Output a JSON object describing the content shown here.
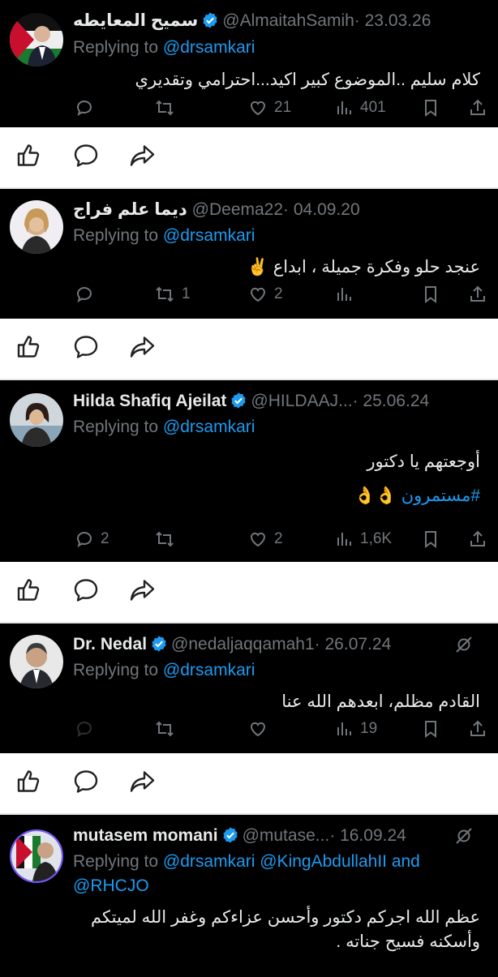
{
  "replying_label": "Replying to",
  "tweets": [
    {
      "name": "سميح المعايطه",
      "handle": "@AlmaitahSamih",
      "date": "· 23.03.26",
      "mention": "@drsamkari",
      "text": "كلام سليم ..الموضوع كبير اكيد...احترامي وتقديري",
      "replies": "",
      "retweets": "",
      "likes": "21",
      "views": "401"
    },
    {
      "name": "ديما علم فراج",
      "handle": "@Deema22",
      "date": "· 04.09.20",
      "mention": "@drsamkari",
      "text": "عنجد حلو وفكرة جميلة ، ابداع ✌️",
      "replies": "",
      "retweets": "1",
      "likes": "2",
      "views": ""
    },
    {
      "name": "Hilda Shafiq Ajeilat",
      "handle": "@HILDAAJ...",
      "date": "· 25.06.24",
      "mention": "@drsamkari",
      "text": "أوجعتهم يا دكتور",
      "hashtag": "#مستمرون",
      "emoji": "👌👌",
      "replies": "2",
      "retweets": "",
      "likes": "2",
      "views": "1,6K"
    },
    {
      "name": "Dr. Nedal",
      "handle": "@nedaljaqqamah1",
      "date": "· 26.07.24",
      "mention": "@drsamkari",
      "text": "القادم مظلم، ابعدهم الله عنا",
      "replies": "",
      "retweets": "",
      "likes": "",
      "views": "19"
    },
    {
      "name": "mutasem momani",
      "handle": "@mutase...",
      "date": "· 16.09.24",
      "mention": "@drsamkari @KingAbdullahII and",
      "mention2": "@RHCJO",
      "text": "عظم الله اجركم دكتور وأحسن عزاءكم وغفر الله لميتكم",
      "text2": "وأسكنه فسيح جناته ."
    }
  ],
  "colors": {
    "background": "#000000",
    "text": "#e7e9ea",
    "muted": "#71767b",
    "link": "#1d9bf0",
    "bar": "#ffffff"
  },
  "icons": [
    "verified-badge-icon",
    "reply-icon",
    "retweet-icon",
    "like-icon",
    "views-icon",
    "bookmark-icon",
    "share-icon",
    "thumbs-up-icon",
    "comment-icon",
    "forward-icon",
    "grok-icon"
  ]
}
